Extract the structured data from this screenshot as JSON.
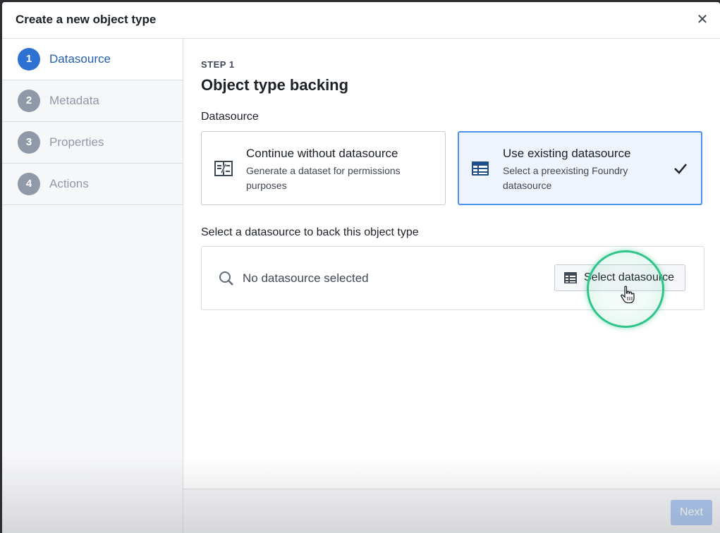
{
  "dialog": {
    "title": "Create a new object type",
    "close_icon": "close-icon"
  },
  "sidebar": {
    "steps": [
      {
        "number": "1",
        "label": "Datasource",
        "active": true
      },
      {
        "number": "2",
        "label": "Metadata",
        "active": false
      },
      {
        "number": "3",
        "label": "Properties",
        "active": false
      },
      {
        "number": "4",
        "label": "Actions",
        "active": false
      }
    ]
  },
  "main": {
    "kicker": "STEP 1",
    "title": "Object type backing",
    "datasource_label": "Datasource",
    "options": [
      {
        "title": "Continue without datasource",
        "description": "Generate a dataset for permissions purposes",
        "icon": "dataset-icon",
        "selected": false
      },
      {
        "title": "Use existing datasource",
        "description": "Select a preexisting Foundry datasource",
        "icon": "table-icon",
        "selected": true
      }
    ],
    "select_label": "Select a datasource to back this object type",
    "empty_text": "No datasource selected",
    "select_button_label": "Select datasource"
  },
  "footer": {
    "next_label": "Next"
  },
  "colors": {
    "accent": "#2d72d2",
    "selected_border": "#4c90f0",
    "highlight": "#2ec48a",
    "next_disabled": "#a8c6f0"
  }
}
